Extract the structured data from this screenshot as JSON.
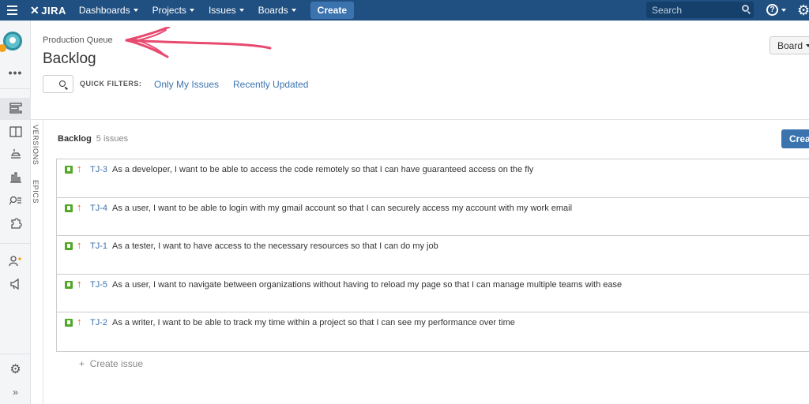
{
  "topnav": {
    "logo": "JIRA",
    "menus": [
      "Dashboards",
      "Projects",
      "Issues",
      "Boards"
    ],
    "create_label": "Create",
    "search_placeholder": "Search",
    "help_glyph": "?",
    "gear_glyph": "⚙",
    "bg_color": "#205081"
  },
  "sidebar": {
    "icons": [
      "avatar-icon",
      "more-icon",
      "backlog-icon",
      "board-icon",
      "releases-icon",
      "reports-icon",
      "issues-icon",
      "components-icon",
      "add-people-icon",
      "feedback-icon",
      "settings-icon",
      "collapse-icon"
    ]
  },
  "header": {
    "breadcrumb": "Production Queue",
    "title": "Backlog",
    "board_label": "Board"
  },
  "quick_filters": {
    "label": "QUICK FILTERS:",
    "items": [
      "Only My Issues",
      "Recently Updated"
    ]
  },
  "vtabs": [
    "VERSIONS",
    "EPICS"
  ],
  "backlog": {
    "title": "Backlog",
    "count": "5 issues",
    "create_sprint_label": "Creat",
    "issues": [
      {
        "key": "TJ-3",
        "priority": "medium",
        "summary": "As a developer, I want to be able to access the code remotely so that I can have guaranteed access on the fly"
      },
      {
        "key": "TJ-4",
        "priority": "medium",
        "summary": "As a user, I want to be able to login with my gmail account so that I can securely access my account with my work email"
      },
      {
        "key": "TJ-1",
        "priority": "medium",
        "summary": "As a tester, I want to have access to the necessary resources so that I can do my job"
      },
      {
        "key": "TJ-5",
        "priority": "high",
        "summary": "As a user, I want to navigate between organizations without having to reload my page so that I can manage multiple teams with ease"
      },
      {
        "key": "TJ-2",
        "priority": "medium",
        "summary": "As a writer, I want to be able to track my time within a project so that I can see my performance over time"
      }
    ],
    "create_issue_label": "Create issue"
  },
  "colors": {
    "link": "#3b73af",
    "story": "#51a825",
    "annotation": "#e84a6f"
  }
}
